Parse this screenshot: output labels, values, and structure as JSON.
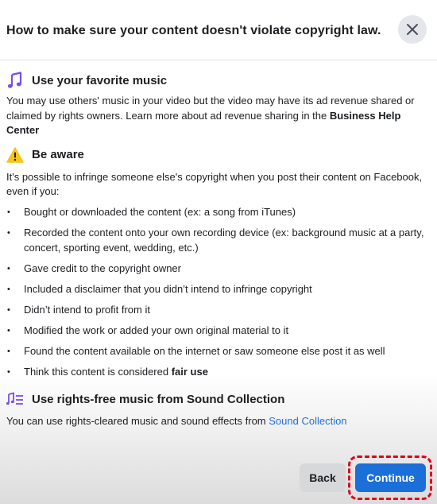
{
  "dialog": {
    "title": "How to make sure your content doesn't violate copyright law.",
    "close_icon": "close-icon"
  },
  "sections": {
    "music": {
      "icon": "music-note-icon",
      "heading": "Use your favorite music",
      "text_before": "You may use others' music in your video but the video may have its ad revenue shared or claimed by rights owners. Learn more about ad revenue sharing in the ",
      "link_bold": "Business Help Center"
    },
    "aware": {
      "icon": "warning-icon",
      "heading": "Be aware",
      "text": "It's possible to infringe someone else's copyright when you post their content on Facebook, even if you:",
      "bullets": [
        "Bought or downloaded the content (ex: a song from iTunes)",
        "Recorded the content onto your own recording device (ex: background music at a party, concert, sporting event, wedding, etc.)",
        "Gave credit to the copyright owner",
        "Included a disclaimer that you didn’t intend to infringe copyright",
        "Didn’t intend to profit from it",
        "Modified the work or added your own original material to it",
        "Found the content available on the internet or saw someone else post it as well"
      ],
      "last_bullet_prefix": "Think this content is considered ",
      "last_bullet_bold": "fair use"
    },
    "sound": {
      "icon": "music-list-icon",
      "heading": "Use rights-free music from Sound Collection",
      "text": "You can use rights-cleared music and sound effects from ",
      "link": "Sound Collection"
    }
  },
  "buttons": {
    "back": "Back",
    "continue": "Continue"
  },
  "colors": {
    "primary": "#1b6fd8",
    "link": "#216fdb",
    "highlight": "#e0001b",
    "icon_purple": "#7b4fe0",
    "warning": "#f5c518"
  }
}
